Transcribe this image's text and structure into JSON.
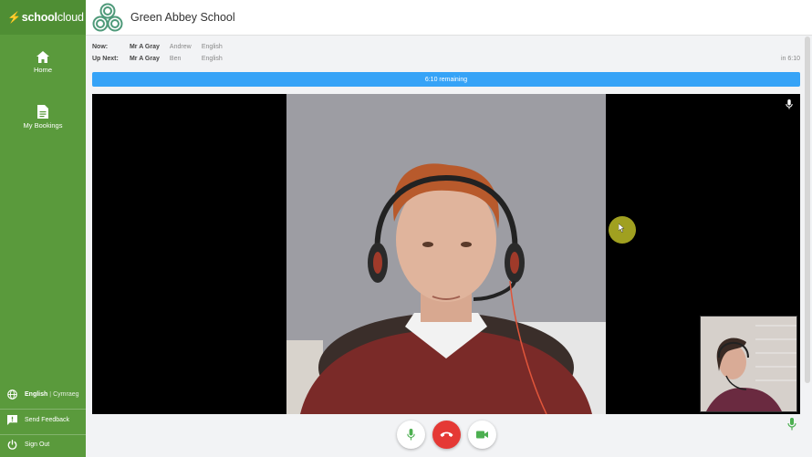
{
  "brand": {
    "bolt": "⚡",
    "name_part1": "school",
    "name_part2": "cloud"
  },
  "header": {
    "school_name": "Green Abbey School"
  },
  "sidebar": {
    "home_label": "Home",
    "bookings_label": "My Bookings",
    "lang_current": "English",
    "lang_sep": "|",
    "lang_alt": "Cymraeg",
    "feedback_label": "Send Feedback",
    "signout_label": "Sign Out"
  },
  "now": {
    "label": "Now:",
    "teacher": "Mr A Gray",
    "pupil": "Andrew",
    "subject": "English"
  },
  "next": {
    "label": "Up Next:",
    "teacher": "Mr A Gray",
    "pupil": "Ben",
    "subject": "English",
    "in": "in 6:10"
  },
  "timer": {
    "text": "6:10 remaining"
  },
  "colors": {
    "sidebar": "#5a9a3c",
    "timer": "#36a3f7",
    "hangup": "#e53935",
    "mic_green": "#4caf50"
  },
  "icons": [
    "home-icon",
    "document-icon",
    "globe-icon",
    "feedback-icon",
    "power-icon",
    "microphone-icon",
    "phone-hangup-icon",
    "video-camera-icon"
  ]
}
